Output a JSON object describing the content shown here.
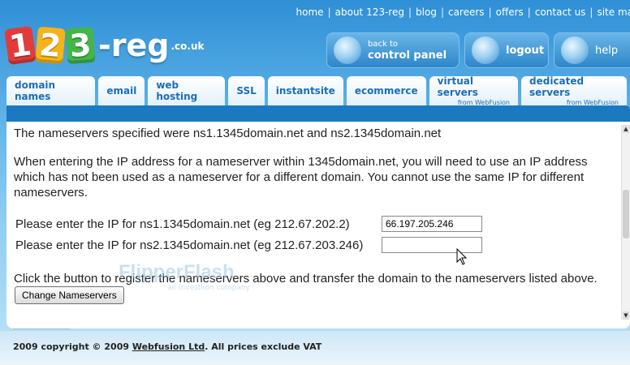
{
  "logo": {
    "d1": "1",
    "d2": "2",
    "d3": "3",
    "reg": "-reg",
    "tld": ".co.uk"
  },
  "topnav": [
    "home",
    "about 123-reg",
    "blog",
    "careers",
    "offers",
    "contact us",
    "site ma"
  ],
  "header": {
    "control_small": "back to",
    "control_big": "control panel",
    "logout": "logout",
    "help": "help"
  },
  "tabs": [
    {
      "label": "domain names",
      "sub": ""
    },
    {
      "label": "email",
      "sub": ""
    },
    {
      "label": "web hosting",
      "sub": ""
    },
    {
      "label": "SSL",
      "sub": ""
    },
    {
      "label": "instantsite",
      "sub": ""
    },
    {
      "label": "ecommerce",
      "sub": ""
    },
    {
      "label": "virtual servers",
      "sub": "from WebFusion"
    },
    {
      "label": "dedicated servers",
      "sub": "from WebFusion"
    }
  ],
  "content": {
    "ns_specified": "The nameservers specified were ns1.1345domain.net and ns2.1345domain.net",
    "instructions": "When entering the IP address for a nameserver within 1345domain.net, you will need to use an IP address which has not been used as a nameserver for a different domain. You cannot use the same IP for different nameservers.",
    "ns1_label": "Please enter the IP for ns1.1345domain.net (eg 212.67.202.2)",
    "ns1_value": "66.197.205.246",
    "ns2_label": "Please enter the IP for ns2.1345domain.net (eg 212.67.203.246)",
    "ns2_value": "",
    "submit_text": "Click the button to register the nameservers above and transfer the domain to the nameservers listed above.",
    "button_label": "Change Nameservers"
  },
  "footer": {
    "copyright_pre": "2009 copyright © 2009 ",
    "company": "Webfusion Ltd",
    "copyright_post": ". All prices exclude VAT"
  },
  "watermark": {
    "brand": "FlipperFlash",
    "tagline": "an investlion company"
  },
  "colors": {
    "tab_text": "#1a6fb5",
    "bar": "#1c79c0",
    "header_blue": "#2e86c9"
  }
}
